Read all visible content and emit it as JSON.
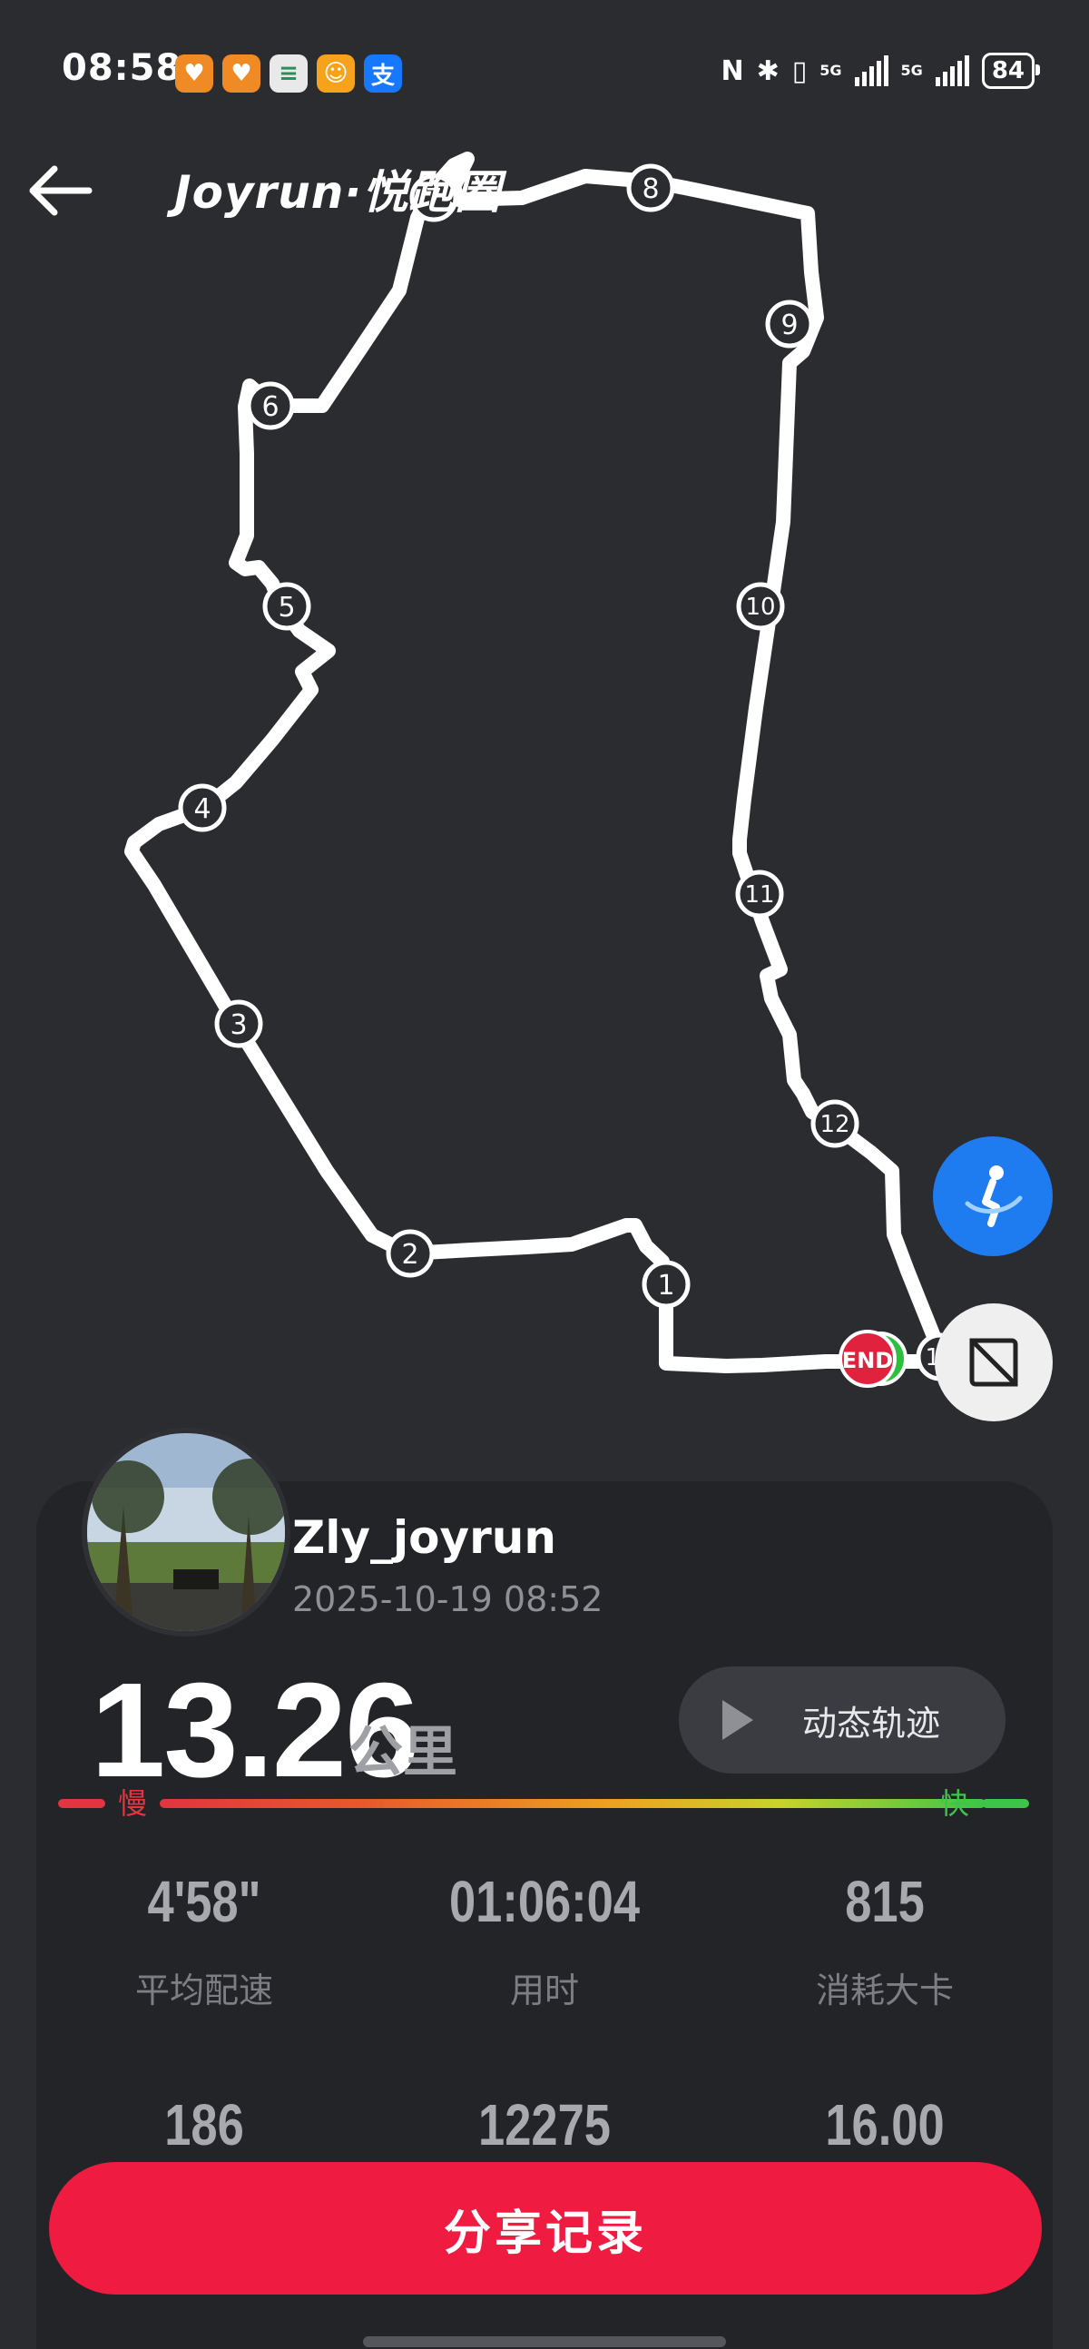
{
  "status_bar": {
    "time": "08:58",
    "battery": "84",
    "net_1": "5G",
    "net_2": "5G",
    "app_icons": [
      {
        "name": "health-app-icon",
        "color": "#f08a24",
        "glyph": "♥"
      },
      {
        "name": "health-app-2-icon",
        "color": "#f08a24",
        "glyph": "♥"
      },
      {
        "name": "wallet-app-icon",
        "color": "#e9e9e9",
        "glyph": "≡"
      },
      {
        "name": "mini-program-icon",
        "color": "#f6a21a",
        "glyph": "☺"
      },
      {
        "name": "alipay-icon",
        "color": "#1678ff",
        "glyph": "支"
      }
    ]
  },
  "header": {
    "brand": "Joyrun·悦跑圈"
  },
  "map": {
    "end_label": "END",
    "markers": [
      "1",
      "2",
      "3",
      "4",
      "5",
      "6",
      "7",
      "8",
      "9",
      "10",
      "11",
      "12",
      "13"
    ],
    "route_color": "#ffffff"
  },
  "summary": {
    "username": "Zly_joyrun",
    "datetime": "2025-10-19 08:52",
    "distance": "13.26",
    "distance_unit": "公里",
    "replay_label": "动态轨迹",
    "pace_slow": "慢",
    "pace_fast": "快",
    "stats": [
      {
        "value": "4'58\"",
        "label": "平均配速"
      },
      {
        "value": "01:06:04",
        "label": "用时"
      },
      {
        "value": "815",
        "label": "消耗大卡"
      },
      {
        "value": "186",
        "label": ""
      },
      {
        "value": "12275",
        "label": ""
      },
      {
        "value": "16.00",
        "label": ""
      }
    ]
  },
  "share_button": "分享记录",
  "colors": {
    "accent": "#f01b41",
    "slow": "#e3343f",
    "fast": "#3cc548",
    "fab_blue": "#1e7bf0"
  }
}
